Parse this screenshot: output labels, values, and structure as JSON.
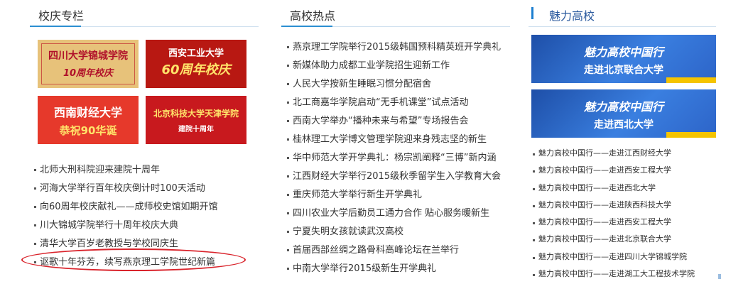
{
  "colors": {
    "accent": "#2c8fd1",
    "highlight_circle": "#d9232b"
  },
  "section1": {
    "title": "校庆专栏",
    "banners": [
      {
        "line1": "四川大学锦城学院",
        "line2": "10周年校庆"
      },
      {
        "line1": "西安工业大学",
        "line2": "60周年校庆"
      },
      {
        "line1": "西南财经大学",
        "line2": "恭祝90华诞"
      },
      {
        "line1": "北京科技大学天津学院",
        "line2": "建院十周年"
      }
    ],
    "items": [
      "北师大刑科院迎来建院十周年",
      "河海大学举行百年校庆倒计时100天活动",
      "向60周年校庆献礼——成师校史馆如期开馆",
      "川大锦城学院举行十周年校庆大典",
      "清华大学百岁老教授与学校同庆生",
      "讴歌十年芬芳，续写燕京理工学院世纪新篇"
    ]
  },
  "section2": {
    "title": "高校热点",
    "items": [
      "燕京理工学院举行2015级韩国预科精英班开学典礼",
      "新媒体助力成都工业学院招生迎新工作",
      "人民大学按新生睡眠习惯分配宿舍",
      "北工商嘉华学院启动“无手机课堂”试点活动",
      "西南大学举办“播种未来与希望”专场报告会",
      "桂林理工大学博文管理学院迎来身残志坚的新生",
      "华中师范大学开学典礼：杨宗凯阐释“三博”新内涵",
      "江西财经大学举行2015级秋季留学生入学教育大会",
      "重庆师范大学举行新生开学典礼",
      "四川农业大学后勤员工通力合作 贴心服务暖新生",
      "宁夏失明女孩就读武汉高校",
      "首届西部丝绸之路骨科高峰论坛在兰举行",
      "中南大学举行2015级新生开学典礼"
    ]
  },
  "section3": {
    "title": "魅力高校",
    "banners": [
      {
        "line1": "魅力高校中国行",
        "line2": "走进北京联合大学"
      },
      {
        "line1": "魅力高校中国行",
        "line2": "走进西北大学"
      }
    ],
    "items": [
      "魅力高校中国行——走进江西财经大学",
      "魅力高校中国行——走进西安工程大学",
      "魅力高校中国行——走进西北大学",
      "魅力高校中国行——走进陕西科技大学",
      "魅力高校中国行——走进西安工程大学",
      "魅力高校中国行——走进北京联合大学",
      "魅力高校中国行——走进四川大学锦城学院",
      "魅力高校中国行——走进湖工大工程技术学院"
    ]
  }
}
